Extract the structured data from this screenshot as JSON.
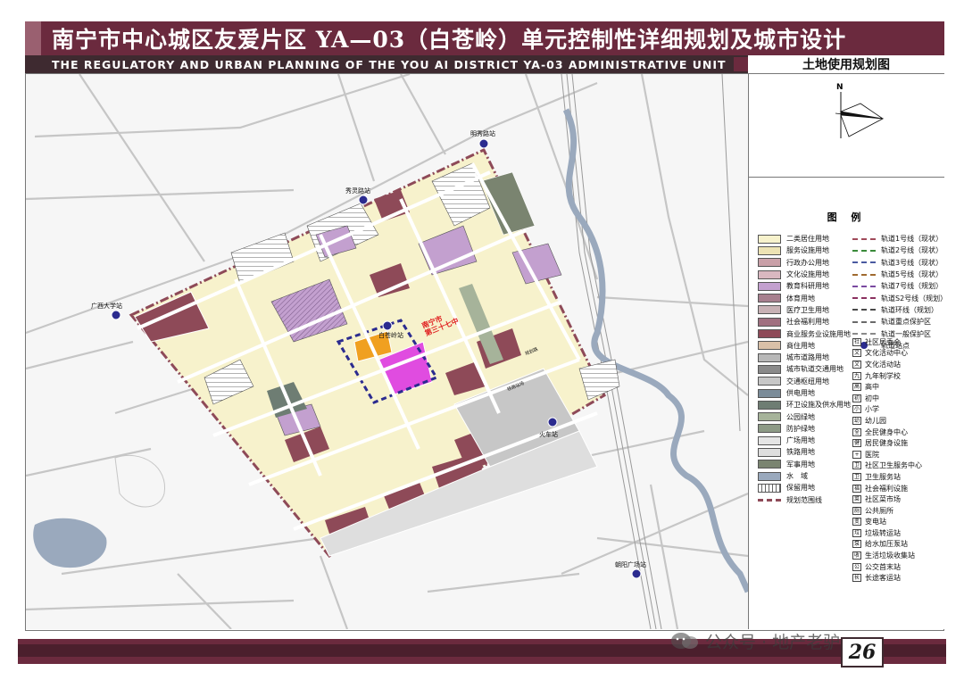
{
  "header": {
    "title_zh": "南宁市中心城区友爱片区 YA—03（白苍岭）单元控制性详细规划及城市设计",
    "title_en": "THE REGULATORY AND URBAN PLANNING OF THE YOU AI DISTRICT YA-03 ADMINISTRATIVE UNIT",
    "map_name": "土地使用规划图"
  },
  "compass": {
    "north_label": "N"
  },
  "map": {
    "stations": [
      {
        "label": "明秀路站"
      },
      {
        "label": "秀灵路站"
      },
      {
        "label": "广西大学站"
      },
      {
        "label": "白苍岭站"
      },
      {
        "label": "火车站"
      },
      {
        "label": "朝阳广场站"
      }
    ],
    "annotation": "南宁市\n第三十七中",
    "road_label_1": "规划路",
    "road_label_2": "铁路站场"
  },
  "legend": {
    "title": "图 例",
    "land_use": [
      {
        "label": "二类居住用地",
        "color": "#f7f2cc"
      },
      {
        "label": "服务设施用地",
        "color": "#ede3b4"
      },
      {
        "label": "行政办公用地",
        "color": "#c9a0a8"
      },
      {
        "label": "文化设施用地",
        "color": "#d9b8c0"
      },
      {
        "label": "教育科研用地",
        "color": "#c3a0cf"
      },
      {
        "label": "体育用地",
        "color": "#a77f8e"
      },
      {
        "label": "医疗卫生用地",
        "color": "#c8b1b5"
      },
      {
        "label": "社会福利用地",
        "color": "#a07080"
      },
      {
        "label": "商业服务业设施用地",
        "color": "#8e4a58"
      },
      {
        "label": "商住用地",
        "color": "#d9c0a8"
      },
      {
        "label": "城市道路用地",
        "color": "#b8b8b8"
      },
      {
        "label": "城市轨道交通用地",
        "color": "#8a8a8a"
      },
      {
        "label": "交通枢纽用地",
        "color": "#c7c7c7"
      },
      {
        "label": "供电用地",
        "color": "#7b8c99"
      },
      {
        "label": "环卫设施及供水用地",
        "color": "#6e7d73"
      },
      {
        "label": "公园绿地",
        "color": "#a6b39a"
      },
      {
        "label": "防护绿地",
        "color": "#8d9a86"
      },
      {
        "label": "广场用地",
        "color": "#e5e5e5"
      },
      {
        "label": "铁路用地",
        "color": "#dedede"
      },
      {
        "label": "军事用地",
        "color": "#7a8470"
      },
      {
        "label": "水　域",
        "color": "#9aa9bd"
      },
      {
        "label": "保留用地",
        "color": "#ffffff"
      },
      {
        "label": "规划范围线",
        "color": "#8e4a58"
      }
    ],
    "transit": [
      {
        "label": "轨道1号线（现状）"
      },
      {
        "label": "轨道2号线（现状）"
      },
      {
        "label": "轨道3号线（现状）"
      },
      {
        "label": "轨道5号线（现状）"
      },
      {
        "label": "轨道7号线（规划）"
      },
      {
        "label": "轨道S2号线（规划）"
      },
      {
        "label": "轨道环线（规划）"
      },
      {
        "label": "轨道重点保护区"
      },
      {
        "label": "轨道一般保护区"
      },
      {
        "label": "轨道站点"
      }
    ],
    "facilities": [
      {
        "label": "社区居委会",
        "icon": "社"
      },
      {
        "label": "文化活动中心",
        "icon": "文"
      },
      {
        "label": "文化活动站",
        "icon": "文"
      },
      {
        "label": "九年制学校",
        "icon": "九"
      },
      {
        "label": "高中",
        "icon": "高"
      },
      {
        "label": "初中",
        "icon": "初"
      },
      {
        "label": "小学",
        "icon": "小"
      },
      {
        "label": "幼儿园",
        "icon": "幼"
      },
      {
        "label": "全民健身中心",
        "icon": "全"
      },
      {
        "label": "居民健身设施",
        "icon": "健"
      },
      {
        "label": "医院",
        "icon": "+"
      },
      {
        "label": "社区卫生服务中心",
        "icon": "卫"
      },
      {
        "label": "卫生服务站",
        "icon": "卫"
      },
      {
        "label": "社会福利设施",
        "icon": "福"
      },
      {
        "label": "社区菜市场",
        "icon": "菜"
      },
      {
        "label": "公共厕所",
        "icon": "厕"
      },
      {
        "label": "变电站",
        "icon": "变"
      },
      {
        "label": "垃圾转运站",
        "icon": "垃"
      },
      {
        "label": "给水加压泵站",
        "icon": "泵"
      },
      {
        "label": "生活垃圾收集站",
        "icon": "收"
      },
      {
        "label": "公交首末站",
        "icon": "公"
      },
      {
        "label": "长途客运站",
        "icon": "长"
      }
    ]
  },
  "footer": {
    "page_number": "26",
    "watermark": "公众号 · 地产老驴"
  }
}
